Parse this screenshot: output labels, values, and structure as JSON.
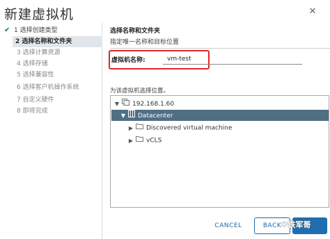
{
  "dialog": {
    "title": "新建虚拟机",
    "close_glyph": "✕"
  },
  "steps": [
    {
      "label": "1 选择创建类型",
      "status": "done",
      "check": "✔"
    },
    {
      "label": "2 选择名称和文件夹",
      "status": "active"
    },
    {
      "label": "3 选择计算资源",
      "status": "pending"
    },
    {
      "label": "4 选择存储",
      "status": "pending"
    },
    {
      "label": "5 选择兼容性",
      "status": "pending"
    },
    {
      "label": "6 选择客户机操作系统",
      "status": "pending"
    },
    {
      "label": "7 自定义硬件",
      "status": "pending"
    },
    {
      "label": "8 即将完成",
      "status": "pending"
    }
  ],
  "section": {
    "title": "选择名称和文件夹",
    "subtitle": "指定唯一名称和目标位置"
  },
  "vm_name": {
    "label": "虚拟机名称:",
    "value": "vm-test"
  },
  "location": {
    "label": "为该虚拟机选择位置。"
  },
  "tree": {
    "host": "192.168.1.60",
    "datacenter": "Datacenter",
    "folders": [
      "Discovered virtual machine",
      "vCLS"
    ],
    "caret_down": "▼",
    "caret_right": "▶"
  },
  "buttons": {
    "cancel": "CANCEL",
    "back": "BACK",
    "next": "NEXT"
  },
  "watermark": {
    "text": "铁军哥",
    "icon": "❀"
  },
  "colors": {
    "highlight_box": "#e1262b",
    "selected_row": "#4f6f83",
    "primary": "#1f6fb0"
  }
}
